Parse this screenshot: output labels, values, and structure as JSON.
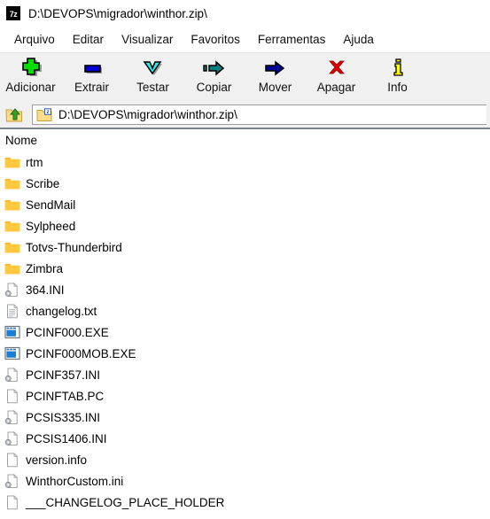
{
  "window": {
    "title": "D:\\DEVOPS\\migrador\\winthor.zip\\",
    "app_icon": "7z"
  },
  "menu": {
    "items": [
      {
        "label": "Arquivo",
        "name": "menu-arquivo"
      },
      {
        "label": "Editar",
        "name": "menu-editar"
      },
      {
        "label": "Visualizar",
        "name": "menu-visualizar"
      },
      {
        "label": "Favoritos",
        "name": "menu-favoritos"
      },
      {
        "label": "Ferramentas",
        "name": "menu-ferramentas"
      },
      {
        "label": "Ajuda",
        "name": "menu-ajuda"
      }
    ]
  },
  "toolbar": {
    "buttons": [
      {
        "label": "Adicionar",
        "icon": "plus-icon",
        "color": "#00dd00"
      },
      {
        "label": "Extrair",
        "icon": "minus-bar-icon",
        "color": "#0000d8"
      },
      {
        "label": "Testar",
        "icon": "chevron-down-icon",
        "color": "#22ecec"
      },
      {
        "label": "Copiar",
        "icon": "copy-arrow-icon",
        "color": "#00807e"
      },
      {
        "label": "Mover",
        "icon": "move-arrow-icon",
        "color": "#000092"
      },
      {
        "label": "Apagar",
        "icon": "delete-x-icon",
        "color": "#e00000"
      },
      {
        "label": "Info",
        "icon": "info-i-icon",
        "color": "#ffff00"
      }
    ]
  },
  "address": {
    "up_icon": "folder-up-icon",
    "folder_icon": "zip-folder-icon",
    "path": "D:\\DEVOPS\\migrador\\winthor.zip\\"
  },
  "list": {
    "columns": [
      "Nome"
    ],
    "rows": [
      {
        "name": "rtm",
        "icon": "folder-icon"
      },
      {
        "name": "Scribe",
        "icon": "folder-icon"
      },
      {
        "name": "SendMail",
        "icon": "folder-icon"
      },
      {
        "name": "Sylpheed",
        "icon": "folder-icon"
      },
      {
        "name": "Totvs-Thunderbird",
        "icon": "folder-icon"
      },
      {
        "name": "Zimbra",
        "icon": "folder-icon"
      },
      {
        "name": "364.INI",
        "icon": "ini-file-icon"
      },
      {
        "name": "changelog.txt",
        "icon": "text-file-icon"
      },
      {
        "name": "PCINF000.EXE",
        "icon": "exe-file-icon"
      },
      {
        "name": "PCINF000MOB.EXE",
        "icon": "exe-file-icon"
      },
      {
        "name": "PCINF357.INI",
        "icon": "ini-file-icon"
      },
      {
        "name": "PCINFTAB.PC",
        "icon": "blank-file-icon"
      },
      {
        "name": "PCSIS335.INI",
        "icon": "ini-file-icon"
      },
      {
        "name": "PCSIS1406.INI",
        "icon": "ini-file-icon"
      },
      {
        "name": "version.info",
        "icon": "blank-file-icon"
      },
      {
        "name": "WinthorCustom.ini",
        "icon": "ini-file-icon"
      },
      {
        "name": "___CHANGELOG_PLACE_HOLDER",
        "icon": "blank-file-icon"
      }
    ]
  },
  "colors": {
    "folder": "#ffc83d",
    "folder_tab": "#f5b829",
    "accent_blue": "#1a7fd4",
    "toolbar_bg": "#f0f0f0",
    "divider": "#7d828c"
  }
}
